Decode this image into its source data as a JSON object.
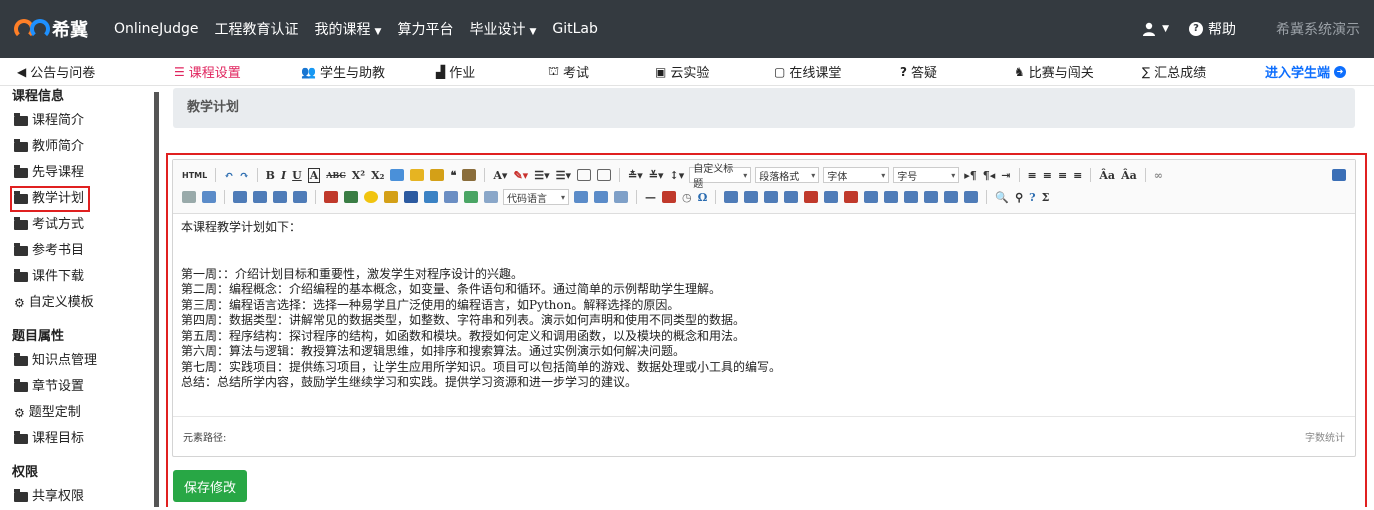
{
  "navbar": {
    "brand": "希冀",
    "links": [
      "OnlineJudge",
      "工程教育认证",
      "我的课程",
      "算力平台",
      "毕业设计",
      "GitLab"
    ],
    "help": "帮助",
    "demo_user": "希冀系统演示"
  },
  "subnav": {
    "items": [
      {
        "label": "公告与问卷",
        "icon": "megaphone-icon"
      },
      {
        "label": "课程设置",
        "icon": "list-icon"
      },
      {
        "label": "学生与助教",
        "icon": "users-icon"
      },
      {
        "label": "作业",
        "icon": "homework-icon"
      },
      {
        "label": "考试",
        "icon": "exam-icon"
      },
      {
        "label": "云实验",
        "icon": "monitor-icon"
      },
      {
        "label": "在线课堂",
        "icon": "classroom-icon"
      },
      {
        "label": "答疑",
        "icon": "question-icon"
      },
      {
        "label": "比赛与闯关",
        "icon": "trophy-icon"
      },
      {
        "label": "汇总成绩",
        "icon": "sigma-icon"
      }
    ],
    "student": "进入学生端"
  },
  "sidebar": {
    "section1": "课程信息",
    "items1": [
      "课程简介",
      "教师简介",
      "先导课程",
      "教学计划",
      "考试方式",
      "参考书目",
      "课件下载",
      "自定义模板"
    ],
    "section2": "题目属性",
    "items2": [
      "知识点管理",
      "章节设置",
      "题型定制",
      "课程目标"
    ],
    "section3": "权限",
    "items3": [
      "共享权限"
    ]
  },
  "page": {
    "title": "教学计划"
  },
  "toolbar": {
    "select_heading": "自定义标题",
    "select_paragraph": "段落格式",
    "select_font": "字体",
    "select_size": "字号",
    "select_code": "代码语言"
  },
  "editor": {
    "intro": "本课程教学计划如下：",
    "lines": [
      "第一周：：介绍计划目标和重要性，激发学生对程序设计的兴趣。",
      "第二周：编程概念：介绍编程的基本概念，如变量、条件语句和循环。通过简单的示例帮助学生理解。",
      "第三周：编程语言选择：选择一种易学且广泛使用的编程语言，如Python。解释选择的原因。",
      "第四周：数据类型：讲解常见的数据类型，如整数、字符串和列表。演示如何声明和使用不同类型的数据。",
      "第五周：程序结构：探讨程序的结构，如函数和模块。教授如何定义和调用函数，以及模块的概念和用法。",
      "第六周：算法与逻辑：教授算法和逻辑思维，如排序和搜索算法。通过实例演示如何解决问题。",
      "第七周：实践项目：提供练习项目，让学生应用所学知识。项目可以包括简单的游戏、数据处理或小工具的编写。",
      "总结：总结所学内容，鼓励学生继续学习和实践。提供学习资源和进一步学习的建议。"
    ],
    "element_path": "元素路径:",
    "word_count": "字数统计"
  },
  "actions": {
    "save": "保存修改"
  }
}
